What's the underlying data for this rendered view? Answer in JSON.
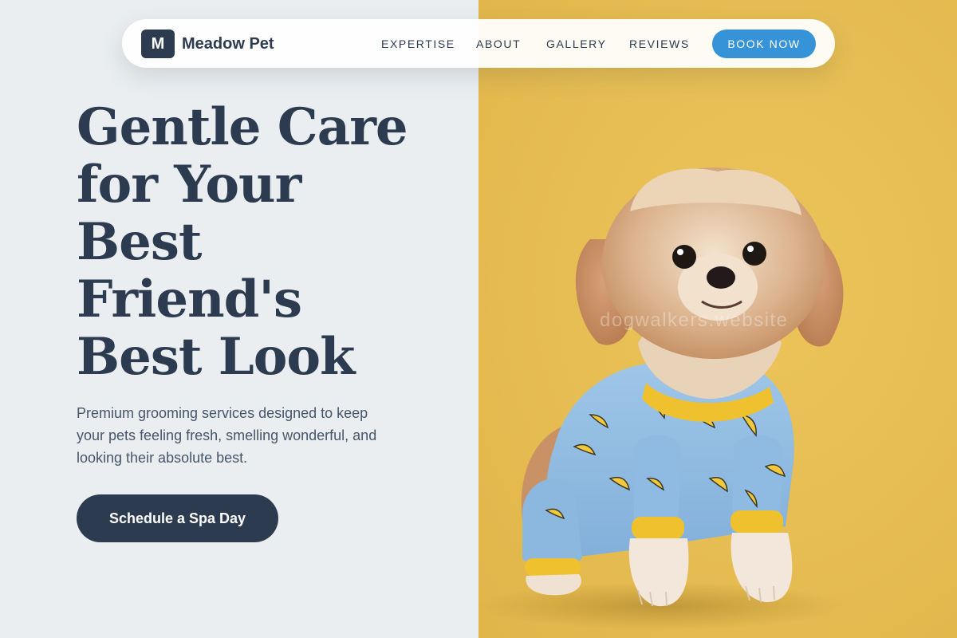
{
  "brand": {
    "logo_letter": "M",
    "name": "Meadow Pet"
  },
  "nav": {
    "links": [
      "EXPERTISE",
      "ABOUT",
      "GALLERY",
      "REVIEWS"
    ],
    "cta_label": "BOOK NOW"
  },
  "hero": {
    "title_lines": [
      "Gentle Care",
      "for Your",
      "Best",
      "Friend's",
      "Best Look"
    ],
    "description_lines": [
      "Premium grooming services designed to keep",
      "your pets feeling fresh, smelling wonderful, and",
      "looking their absolute best."
    ],
    "cta_label": "Schedule a Spa Day"
  },
  "image": {
    "watermark": "dogwalkers.website",
    "subject_icon": "dog-in-banana-pajamas-illustration"
  },
  "colors": {
    "navy": "#2c3b4f",
    "accent_blue": "#3793d8",
    "left_background": "#eaeef0",
    "photo_background": "#e6bd52"
  }
}
